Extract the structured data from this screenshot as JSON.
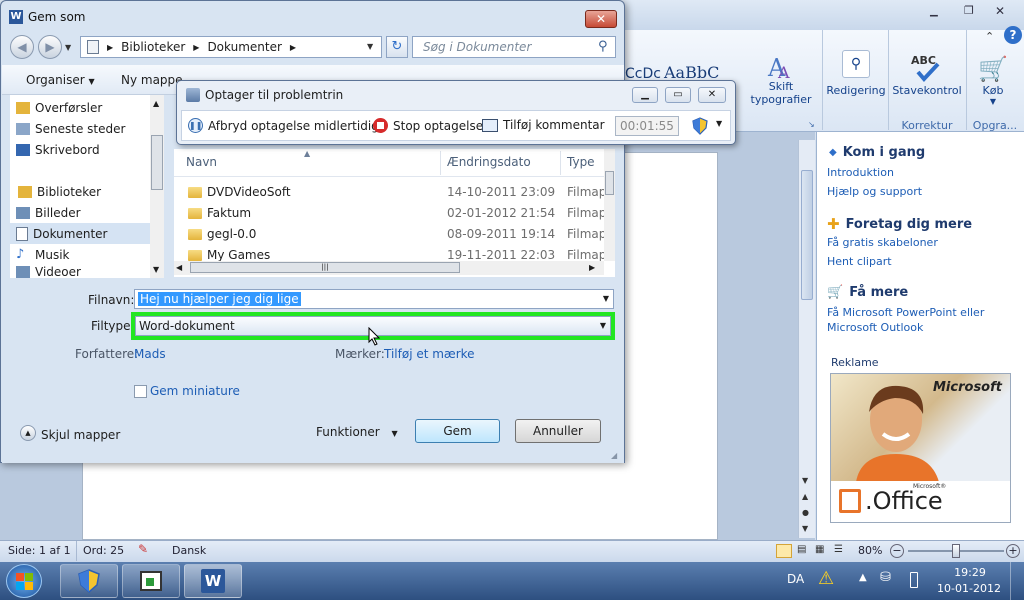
{
  "word": {
    "ribbon": {
      "styles_preview": [
        "CcDc",
        "AaBbC"
      ],
      "skift_typografier": "Skift typografier",
      "redigering": "Redigering",
      "stavekontrol": "Stavekontrol",
      "korrektur": "Korrektur",
      "kob": "Køb",
      "opgra": "Opgra..."
    },
    "taskpane": {
      "kom_i_gang": "Kom i gang",
      "introduktion": "Introduktion",
      "hjaelp": "Hjælp og support",
      "foretag": "Foretag dig mere",
      "skabeloner": "Få gratis skabeloner",
      "clipart": "Hent clipart",
      "faa_mere": "Få mere",
      "ms_link": "Få Microsoft PowerPoint eller Microsoft Outlook",
      "reklame": "Reklame",
      "ad_brand": "Microsoft",
      "ad_office_small": "Microsoft®",
      "ad_office": ".Office"
    },
    "status": {
      "side": "Side: 1 af 1",
      "ord": "Ord: 25",
      "sprog": "Dansk",
      "zoom": "80%",
      "zoom_level": 0.5
    }
  },
  "dialog": {
    "title": "Gem som",
    "address": [
      "Biblioteker",
      "Dokumenter"
    ],
    "search_placeholder": "Søg i Dokumenter",
    "toolbar": {
      "organiser": "Organiser",
      "ny_mappe": "Ny mappe"
    },
    "nav": [
      "Overførsler",
      "Seneste steder",
      "Skrivebord",
      "Biblioteker",
      "Billeder",
      "Dokumenter",
      "Musik",
      "Videoer"
    ],
    "columns": {
      "name": "Navn",
      "date": "Ændringsdato",
      "type": "Type"
    },
    "files": [
      {
        "name": "DVDVideoSoft",
        "date": "14-10-2011 23:09",
        "type": "Filmap"
      },
      {
        "name": "Faktum",
        "date": "02-01-2012 21:54",
        "type": "Filmap"
      },
      {
        "name": "gegl-0.0",
        "date": "08-09-2011 19:14",
        "type": "Filmap"
      },
      {
        "name": "My Games",
        "date": "19-11-2011 22:03",
        "type": "Filmap"
      }
    ],
    "filnavn_label": "Filnavn:",
    "filnavn_value": "Hej nu hjælper jeg dig lige",
    "filtype_label": "Filtype:",
    "filtype_value": "Word-dokument",
    "forfattere_label": "Forfattere:",
    "forfattere_value": "Mads",
    "maerker_label": "Mærker:",
    "maerker_value": "Tilføj et mærke",
    "miniature": "Gem miniature",
    "skjul": "Skjul mapper",
    "funktioner": "Funktioner",
    "gem": "Gem",
    "annuller": "Annuller"
  },
  "psr": {
    "title": "Optager til problemtrin",
    "afbryd": "Afbryd optagelse midlertidigt",
    "stop": "Stop optagelse",
    "kommentar": "Tilføj kommentar",
    "timer": "00:01:55"
  },
  "taskbar": {
    "lang": "DA",
    "time": "19:29",
    "date": "10-01-2012"
  },
  "colors": {
    "highlight": "#22e622",
    "link": "#1d5db5"
  }
}
